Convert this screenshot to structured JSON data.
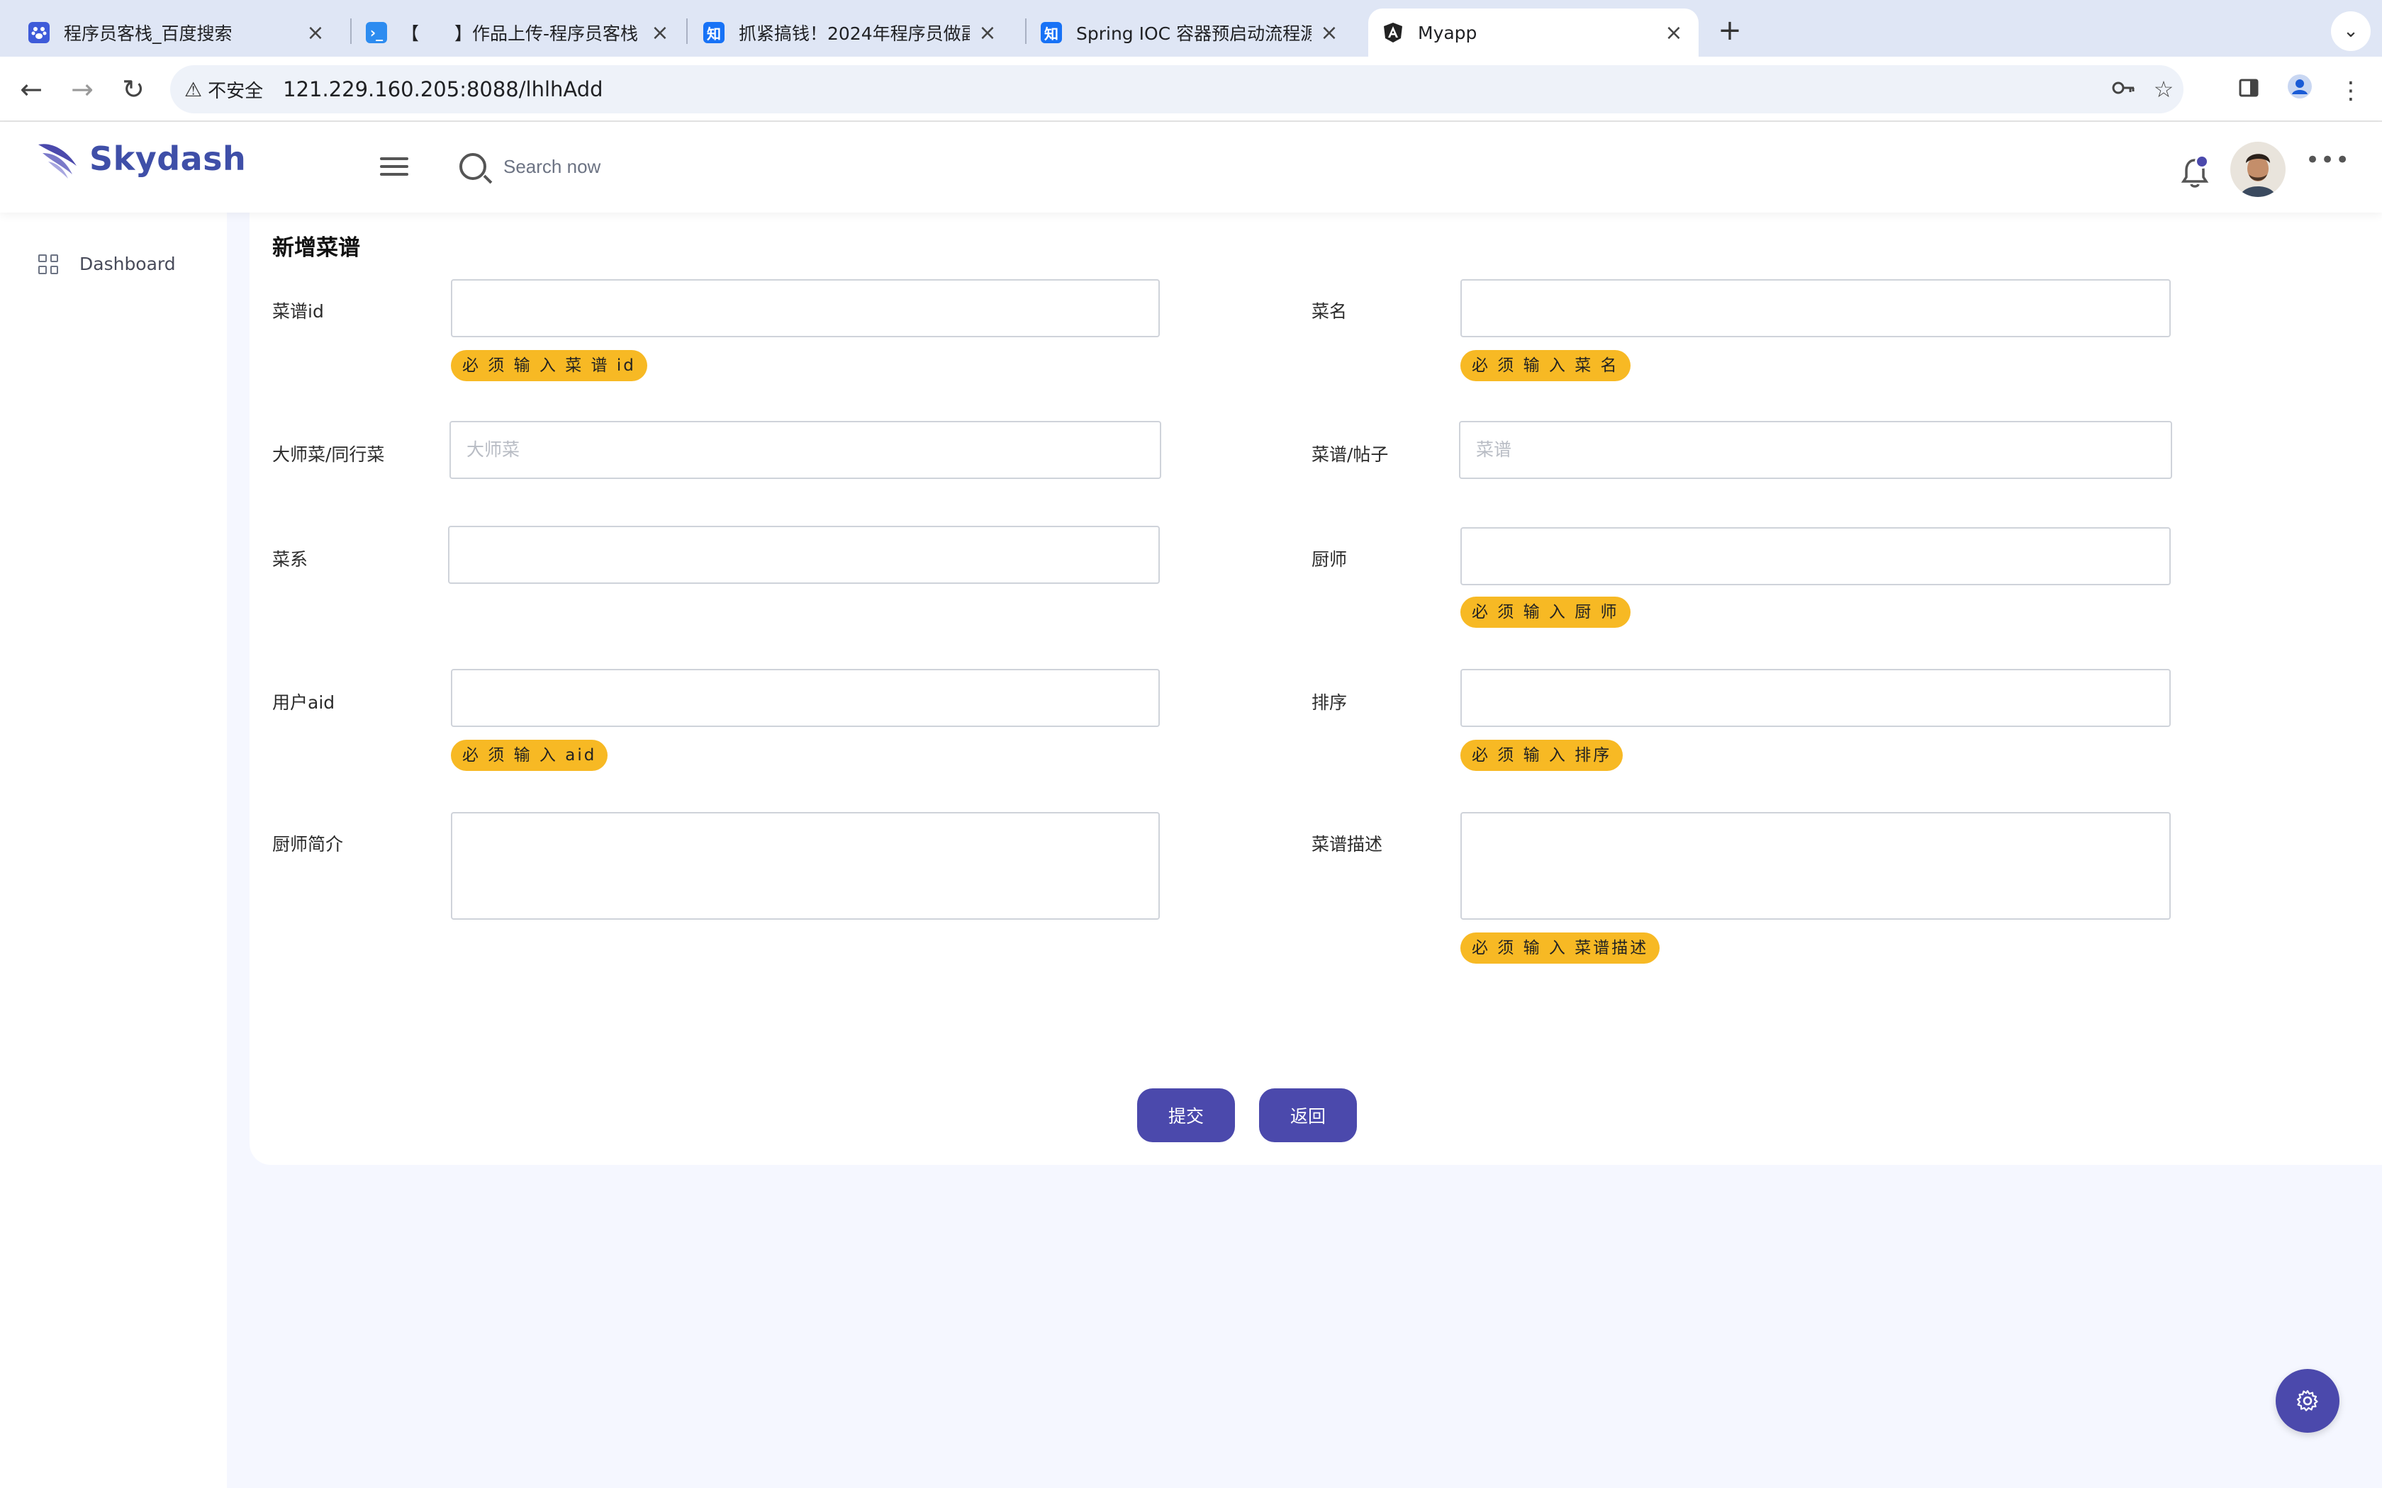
{
  "browser": {
    "tabs": [
      {
        "title": "程序员客栈_百度搜索",
        "icon": "baidu-paw-icon"
      },
      {
        "title": "【　　】作品上传-程序员客栈",
        "icon": "terminal-icon"
      },
      {
        "title": "抓紧搞钱！2024年程序员做副业",
        "icon": "zhihu-icon"
      },
      {
        "title": "Spring IOC 容器预启动流程源码",
        "icon": "zhihu-icon"
      },
      {
        "title": "Myapp",
        "icon": "angular-icon"
      }
    ],
    "new_tab_symbol": "+",
    "security_label": "不安全",
    "url": "121.229.160.205:8088/lhlhAdd"
  },
  "header": {
    "brand": "Skydash",
    "search_placeholder": "Search now"
  },
  "sidebar": {
    "items": [
      {
        "label": "Dashboard",
        "icon": "grid-icon"
      }
    ]
  },
  "form": {
    "title": "新增菜谱",
    "fields": {
      "recipe_id": {
        "label": "菜谱id",
        "value": "",
        "placeholder": "",
        "warning": "必 须 输 入 菜 谱 id"
      },
      "dish_name": {
        "label": "菜名",
        "value": "",
        "placeholder": "",
        "warning": "必 须 输 入 菜 名"
      },
      "master_dish": {
        "label": "大师菜/同行菜",
        "value": "",
        "placeholder": "大师菜"
      },
      "recipe_post": {
        "label": "菜谱/帖子",
        "value": "",
        "placeholder": "菜谱"
      },
      "cuisine": {
        "label": "菜系",
        "value": "",
        "placeholder": ""
      },
      "chef": {
        "label": "厨师",
        "value": "",
        "placeholder": "",
        "warning": "必 须 输 入 厨 师"
      },
      "user_aid": {
        "label": "用户aid",
        "value": "",
        "placeholder": "",
        "warning": "必 须 输 入 aid"
      },
      "sort_order": {
        "label": "排序",
        "value": "",
        "placeholder": "",
        "warning": "必 须 输 入 排序"
      },
      "chef_intro": {
        "label": "厨师简介",
        "value": ""
      },
      "recipe_desc": {
        "label": "菜谱描述",
        "value": "",
        "warning": "必 须 输 入 菜谱描述"
      }
    },
    "submit_label": "提交",
    "back_label": "返回"
  },
  "colors": {
    "primary": "#4b49ac",
    "warning_badge": "#f7b924",
    "page_bg": "#f5f7ff",
    "tabbar_bg": "#dfe6f5"
  },
  "settings_fab_icon": "gear-icon"
}
